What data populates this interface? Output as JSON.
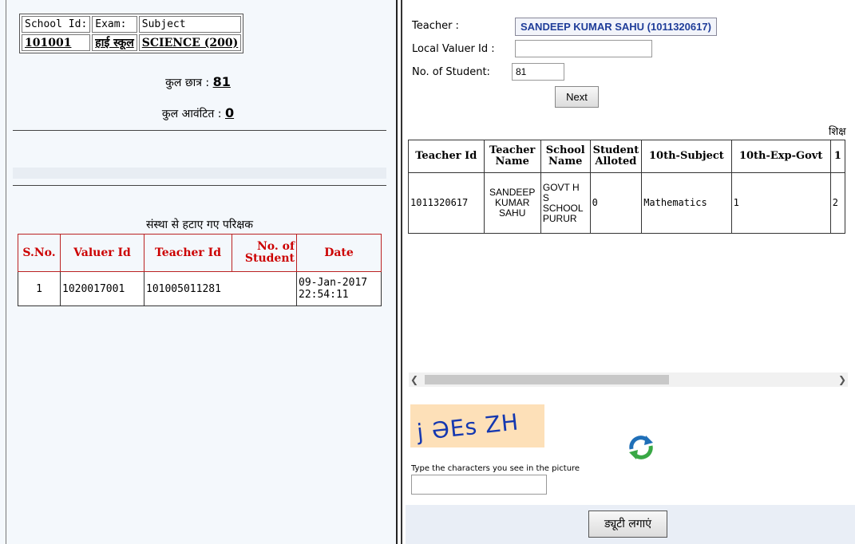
{
  "exam_info": {
    "headers": [
      "School Id:",
      "Exam:",
      "Subject"
    ],
    "values": [
      "101001",
      "हाई स्कूल",
      "SCIENCE (200)"
    ]
  },
  "stats": {
    "total_students_label": "कुल छात्र :",
    "total_students": "81",
    "total_allotted_label": "कुल आवंटित :",
    "total_allotted": "0"
  },
  "removed_valuers": {
    "title": "संस्था से हटाए गए परिक्षक",
    "headers": [
      "S.No.",
      "Valuer Id",
      "Teacher Id",
      "No. of Student",
      "Date"
    ],
    "rows": [
      {
        "sno": "1",
        "valuer_id": "1020017001",
        "teacher_id": "101005011281",
        "no_of_student": "",
        "date": "09-Jan-2017 22:54:11"
      }
    ]
  },
  "form": {
    "teacher_label": "Teacher :",
    "teacher_value": "SANDEEP KUMAR SAHU (1011320617)",
    "local_valuer_label": "Local Valuer Id :",
    "local_valuer_value": "",
    "no_of_student_label": "No. of Student:",
    "no_of_student_value": "81",
    "next_button": "Next"
  },
  "teacher_grid": {
    "caption_fragment": "शिक्ष",
    "headers": [
      "Teacher Id",
      "Teacher Name",
      "School Name",
      "Student Alloted",
      "10th-Subject",
      "10th-Exp-Govt",
      "1"
    ],
    "rows": [
      {
        "teacher_id": "1011320617",
        "teacher_name": "SANDEEP KUMAR SAHU",
        "school_name": "GOVT H S SCHOOL PURUR",
        "student_alloted": "0",
        "subject": "Mathematics",
        "exp_govt": "1",
        "next_col": "2"
      }
    ]
  },
  "captcha": {
    "text": "j ƏEs ZH",
    "prompt": "Type the characters you see in the picture",
    "input_value": "",
    "refresh_icon": "refresh-icon"
  },
  "submit_button": "ड्यूटी लगाएं",
  "colors": {
    "header_red": "#cc0000",
    "teacher_blue": "#1f3d99",
    "captcha_bg": "#fde0b8"
  }
}
